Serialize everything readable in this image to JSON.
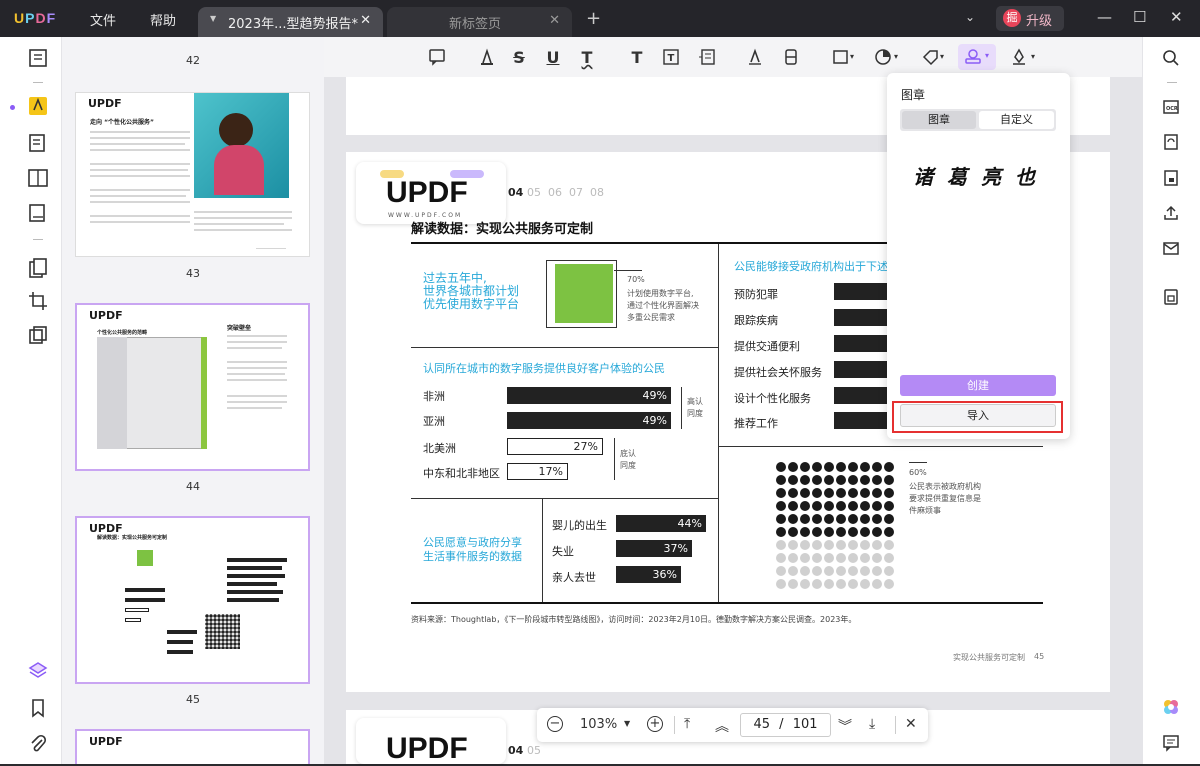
{
  "app": {
    "brand": "UPDF"
  },
  "menu": {
    "file": "文件",
    "help": "帮助"
  },
  "tabs": [
    {
      "label": "2023年...型趋势报告*",
      "active": true
    },
    {
      "label": "新标签页",
      "active": false
    }
  ],
  "upgrade": {
    "icon_char": "掘",
    "label": "升级"
  },
  "thumbnails": {
    "pages": [
      "42",
      "43",
      "44",
      "45"
    ],
    "t43_heading": "走向 “个性化公共服务”",
    "t44_heading": "个性化公共服务的范畴",
    "t44_side": "突破壁垒",
    "t45_heading": "解读数据：实现公共服务可定制"
  },
  "page": {
    "logo_text": "UPDF",
    "logo_url": "WWW.UPDF.COM",
    "nums": [
      "04",
      "05",
      "06",
      "07",
      "08"
    ],
    "title": "解读数据：实现公共服务可定制",
    "left_block_1": [
      "过去五年中,",
      "世界各城市都计划",
      "优先使用数字平台"
    ],
    "pct_70": "70%",
    "pct_70_desc": [
      "计划使用数字平台,",
      "通过个性化界面解决",
      "多重公民需求"
    ],
    "experience_title": "认同所在城市的数字服务提供良好客户体验的公民",
    "regions": [
      {
        "name": "非洲",
        "value": "49%"
      },
      {
        "name": "亚洲",
        "value": "49%"
      },
      {
        "name": "北美洲",
        "value": "27%"
      },
      {
        "name": "中东和北非地区",
        "value": "17%"
      }
    ],
    "high_label": [
      "高认",
      "同度"
    ],
    "low_label": [
      "底认",
      "同度"
    ],
    "share_block": [
      "公民愿意与政府分享",
      "生活事件服务的数据"
    ],
    "events": [
      {
        "name": "婴儿的出生",
        "value": "44%"
      },
      {
        "name": "失业",
        "value": "37%"
      },
      {
        "name": "亲人去世",
        "value": "36%"
      }
    ],
    "right_title": "公民能够接受政府机构出于下述",
    "right_items": [
      "预防犯罪",
      "跟踪疾病",
      "提供交通便利",
      "提供社会关怀服务",
      "设计个性化服务",
      "推荐工作"
    ],
    "pct_60": "60%",
    "pct_60_desc": [
      "公民表示被政府机构",
      "要求提供重复信息是",
      "件麻烦事"
    ],
    "source": "资料来源：Thoughtlab，《下一阶段城市转型路线图》，访问时间：2023年2月10日。德勤数字解决方案公民调查。2023年。",
    "footer": "实现公共服务可定制",
    "footer_num": "45"
  },
  "stamp_popup": {
    "title": "图章",
    "seg_a": "图章",
    "seg_b": "自定义",
    "stamp_text": "诸葛亮也",
    "create": "创建",
    "import": "导入"
  },
  "nav": {
    "zoom": "103%",
    "current_page": "45",
    "sep": "/",
    "total_pages": "101"
  },
  "colors": {
    "accent": "#b48af5",
    "highlight_red": "#e53030",
    "bar_green": "#7dc242",
    "cyan_text": "#27a8d8"
  }
}
